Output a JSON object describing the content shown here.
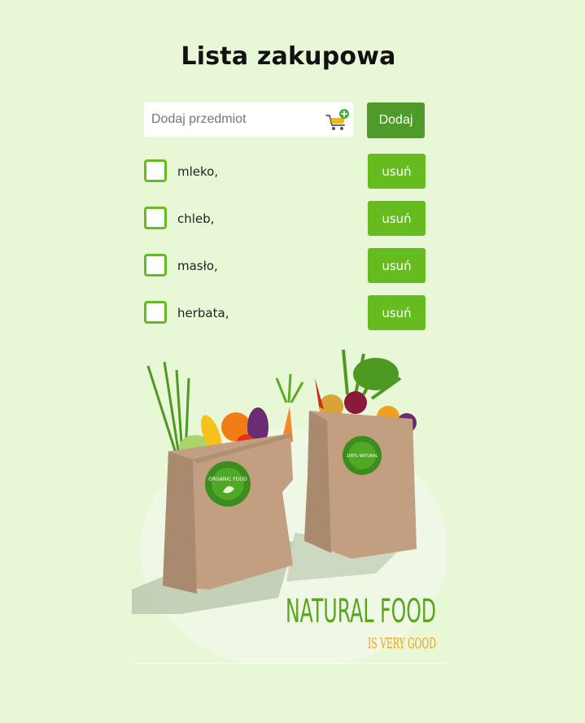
{
  "header": {
    "title": "Lista zakupowa"
  },
  "add_form": {
    "placeholder": "Dodaj przedmiot",
    "value": "",
    "cart_icon": "cart-plus-icon",
    "add_label": "Dodaj"
  },
  "items": [
    {
      "label": "mleko,",
      "checked": false,
      "remove_label": "usuń"
    },
    {
      "label": "chleb,",
      "checked": false,
      "remove_label": "usuń"
    },
    {
      "label": "masło,",
      "checked": false,
      "remove_label": "usuń"
    },
    {
      "label": "herbata,",
      "checked": false,
      "remove_label": "usuń"
    }
  ],
  "illustration": {
    "badge_left": "ORGANIC FOOD",
    "badge_right": "100% NATURAL",
    "headline": "NATURAL FOOD",
    "tagline": "IS VERY GOOD"
  },
  "colors": {
    "background": "#e8f7d5",
    "add_button": "#4e9b2c",
    "remove_button": "#66bb1e",
    "checkbox_border": "#66bb22",
    "headline": "#5aa41e",
    "tagline": "#f0a020"
  }
}
